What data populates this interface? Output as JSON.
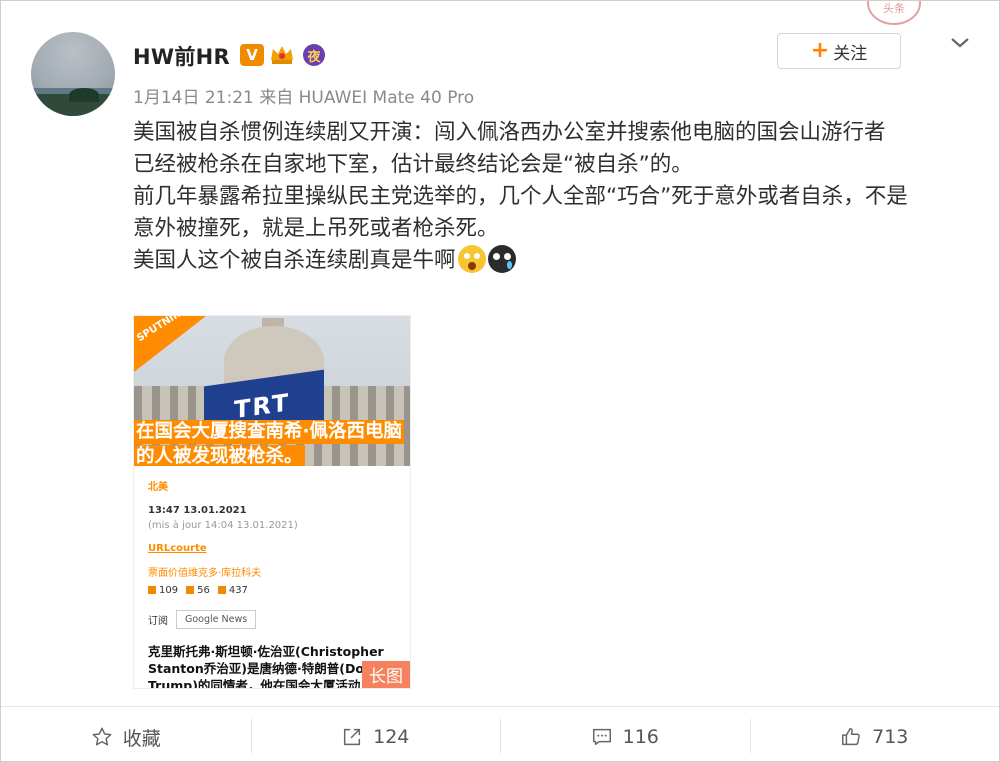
{
  "author": {
    "name": "HW前HR",
    "badges": {
      "verified": "V",
      "night": "夜"
    }
  },
  "meta": {
    "text": "1月14日 21:21 来自 HUAWEI Mate 40 Pro"
  },
  "header": {
    "follow_label": "关注",
    "follow_plus": "+"
  },
  "post": {
    "lines": [
      "美国被自杀惯例连续剧又开演：闯入佩洛西办公室并搜索他电脑的国会山游行者",
      "已经被枪杀在自家地下室，估计最终结论会是“被自杀”的。",
      "前几年暴露希拉里操纵民主党选举的，几个人全部“巧合”死于意外或者自杀，不是",
      "意外被撞死，就是上吊死或者枪杀死。",
      "美国人这个被自杀连续剧真是牛啊"
    ],
    "emojis": [
      "shocked-face-icon",
      "crying-face-icon"
    ]
  },
  "image": {
    "brand": "SPUTNIK",
    "flag_text": "TRT",
    "headline": [
      "在国会大厦搜查南希·佩洛西电脑",
      "的人被发现被枪杀。"
    ],
    "region": "北美",
    "time": "13:47 13.01.2021",
    "updated": "(mis à jour 14:04 13.01.2021)",
    "url": "URLcourte",
    "byline": "票面价值维克多·库拉科夫",
    "reactions": [
      "109",
      "56",
      "437"
    ],
    "subscribe_label": "订阅",
    "gnews_label": "Google News",
    "paragraph": [
      "克里斯托弗·斯坦顿·佐治亚(Christopher",
      "Stanton乔治亚)是唐纳德·特朗普(Donald",
      "Trump)的同情者，他在国会大厦活动"
    ],
    "long_tag": "长图"
  },
  "actions": {
    "favorite_label": "收藏",
    "repost_count": "124",
    "comment_count": "116",
    "like_count": "713"
  },
  "colors": {
    "accent": "#ff8200",
    "sputnik_orange": "#ff8c00"
  }
}
